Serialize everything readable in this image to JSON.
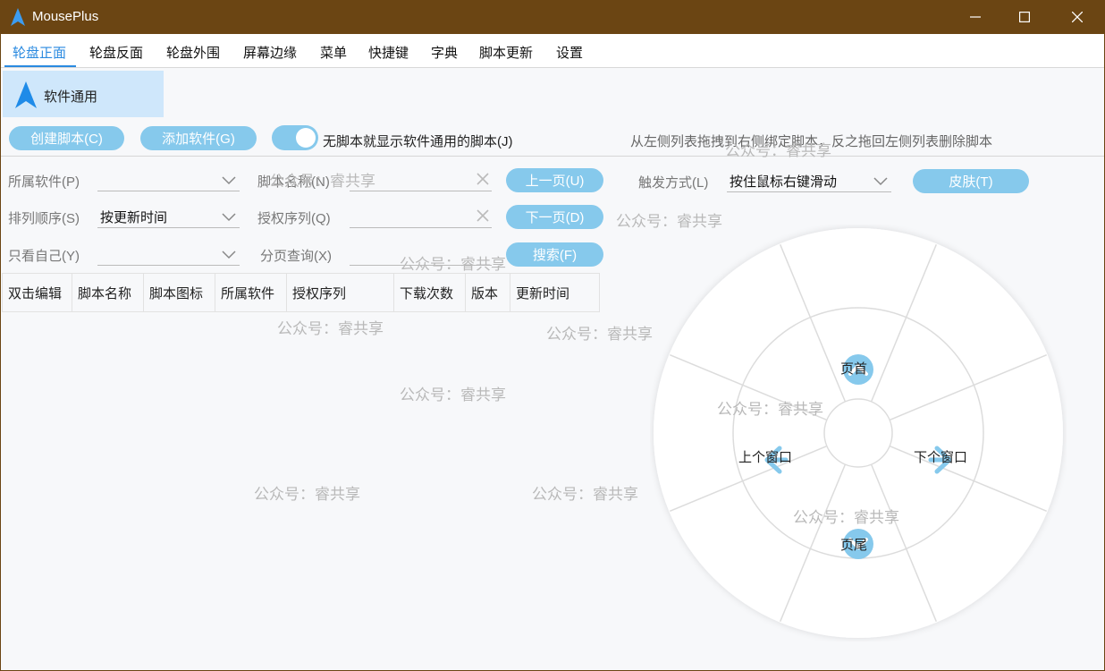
{
  "window": {
    "title": "MousePlus"
  },
  "menu": {
    "items": [
      "轮盘正面",
      "轮盘反面",
      "轮盘外围",
      "屏幕边缘",
      "菜单",
      "快捷键",
      "字典",
      "脚本更新",
      "设置"
    ]
  },
  "software": {
    "selected": "软件通用"
  },
  "actions": {
    "create_script": "创建脚本(C)",
    "add_software": "添加软件(G)",
    "toggle_label": "无脚本就显示软件通用的脚本(J)",
    "hint": "从左侧列表拖拽到右侧绑定脚本，反之拖回左侧列表删除脚本"
  },
  "filters": {
    "software_label": "所属软件(P)",
    "software_value": "",
    "script_name_label": "脚本名称(N)",
    "sort_label": "排列顺序(S)",
    "sort_value": "按更新时间",
    "auth_label": "授权序列(Q)",
    "only_mine_label": "只看自己(Y)",
    "only_mine_value": "",
    "page_query_label": "分页查询(X)",
    "prev_page": "上一页(U)",
    "next_page": "下一页(D)",
    "search": "搜索(F)",
    "trigger_label": "触发方式(L)",
    "trigger_value": "按住鼠标右键滑动",
    "skin": "皮肤(T)"
  },
  "table": {
    "columns": [
      "双击编辑",
      "脚本名称",
      "脚本图标",
      "所属软件",
      "授权序列",
      "下载次数",
      "版本",
      "更新时间"
    ]
  },
  "wheel": {
    "top": "页首",
    "left": "上个窗口",
    "right": "下个窗口",
    "bottom": "页尾"
  },
  "watermark": "公众号：睿共享",
  "colors": {
    "titlebar": "#6b4513",
    "accent": "#2a8ae0",
    "pill": "#86c9ec",
    "selected": "#cfe7fb"
  }
}
